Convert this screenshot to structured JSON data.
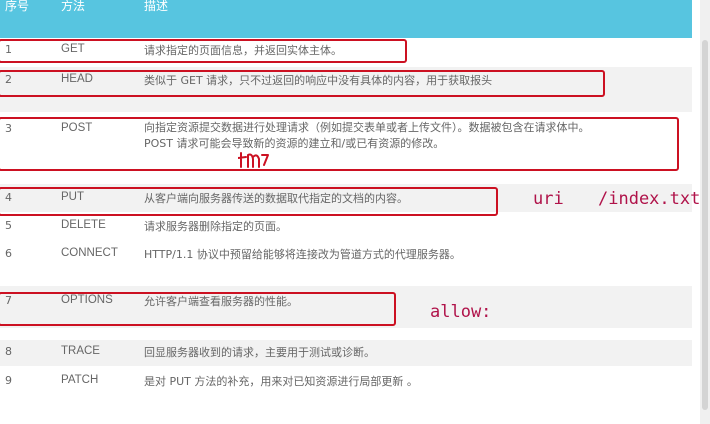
{
  "table": {
    "headers": [
      "序号",
      "方法",
      "描述"
    ],
    "rows": [
      {
        "no": "1",
        "method": "GET",
        "desc": "请求指定的页面信息，并返回实体主体。"
      },
      {
        "no": "2",
        "method": "HEAD",
        "desc": "类似于 GET 请求，只不过返回的响应中没有具体的内容，用于获取报头"
      },
      {
        "no": "3",
        "method": "POST",
        "desc": [
          "向指定资源提交数据进行处理请求（例如提交表单或者上传文件）。数据被包含在请求体中。",
          "POST 请求可能会导致新的资源的建立和/或已有资源的修改。"
        ]
      },
      {
        "no": "4",
        "method": "PUT",
        "desc": "从客户端向服务器传送的数据取代指定的文档的内容。"
      },
      {
        "no": "5",
        "method": "DELETE",
        "desc": "请求服务器删除指定的页面。"
      },
      {
        "no": "6",
        "method": "CONNECT",
        "desc": "HTTP/1.1 协议中预留给能够将连接改为管道方式的代理服务器。"
      },
      {
        "no": "7",
        "method": "OPTIONS",
        "desc": "允许客户端查看服务器的性能。"
      },
      {
        "no": "8",
        "method": "TRACE",
        "desc": "回显服务器收到的请求，主要用于测试或诊断。"
      },
      {
        "no": "9",
        "method": "PATCH",
        "desc": "是对 PUT 方法的补充，用来对已知资源进行局部更新 。"
      }
    ]
  },
  "annotations": {
    "uri_label": "uri",
    "uri_path": "/index.txt",
    "allow_label": "allow:"
  },
  "colors": {
    "header_bg": "#57c5e0",
    "alt_row_bg": "#f2f2f2",
    "highlight_box": "#cc1122",
    "note_text": "#b0134a"
  }
}
